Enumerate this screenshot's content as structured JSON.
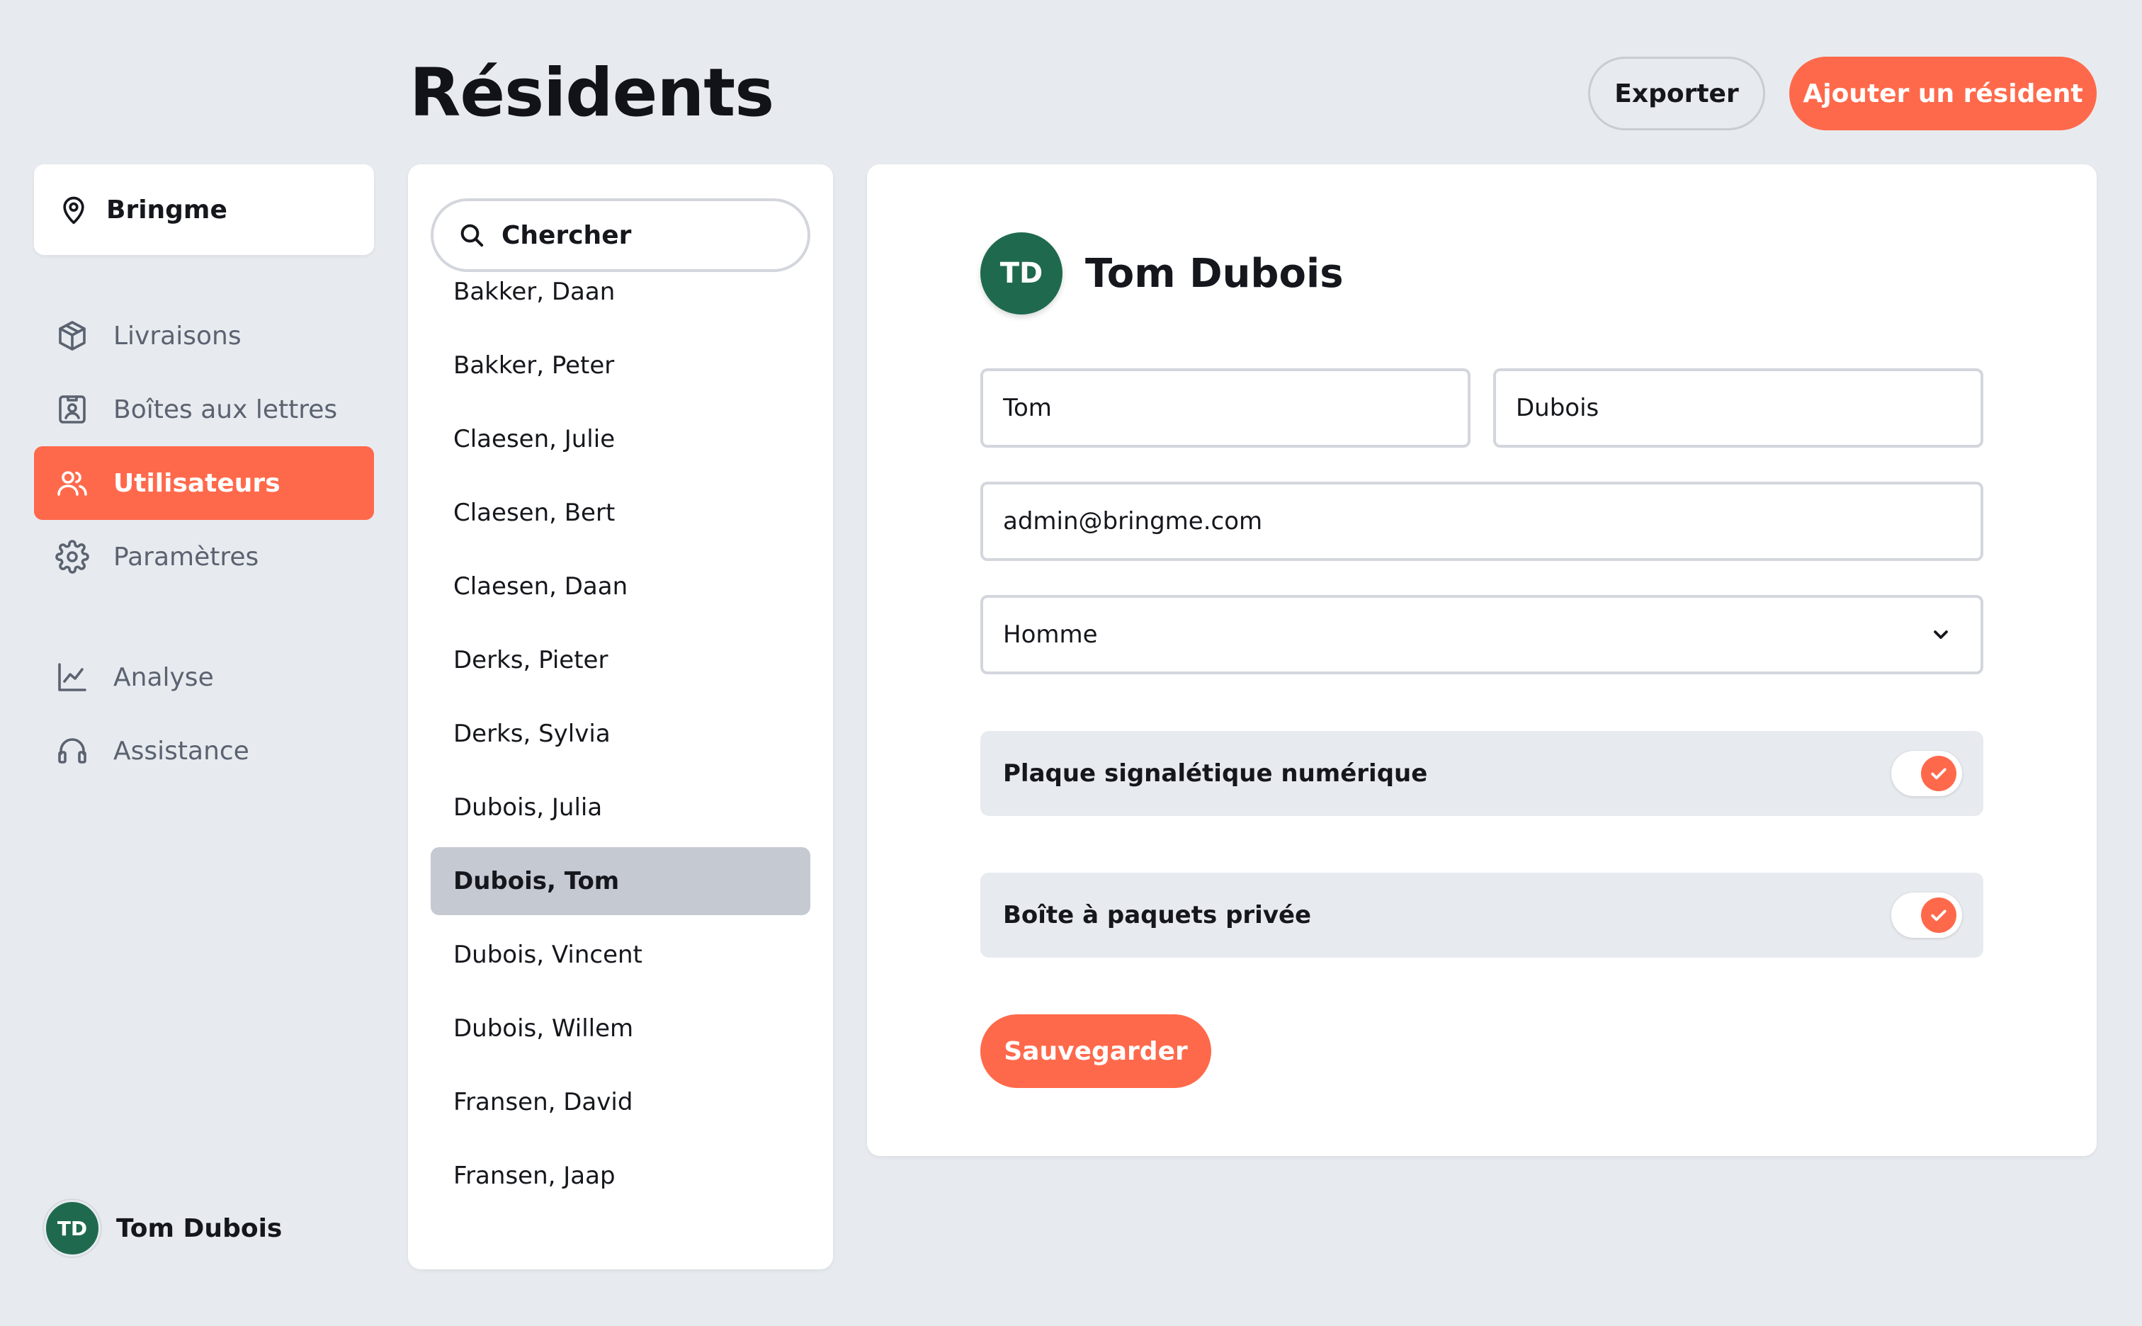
{
  "header": {
    "title": "Résidents",
    "export_label": "Exporter",
    "add_label": "Ajouter un résident"
  },
  "sidebar": {
    "org": {
      "label": "Bringme",
      "icon": "location-pin-icon"
    },
    "items": [
      {
        "label": "Livraisons",
        "icon": "package-icon",
        "active": false
      },
      {
        "label": "Boîtes aux lettres",
        "icon": "mailbox-icon",
        "active": false
      },
      {
        "label": "Utilisateurs",
        "icon": "users-icon",
        "active": true
      },
      {
        "label": "Paramètres",
        "icon": "gear-icon",
        "active": false
      },
      {
        "label": "Analyse",
        "icon": "chart-icon",
        "active": false
      },
      {
        "label": "Assistance",
        "icon": "headset-icon",
        "active": false
      }
    ],
    "user": {
      "initials": "TD",
      "name": "Tom Dubois"
    }
  },
  "list": {
    "search_placeholder": "Chercher",
    "items": [
      "Bakker, Daan",
      "Bakker, Peter",
      "Claesen, Julie",
      "Claesen, Bert",
      "Claesen, Daan",
      "Derks, Pieter",
      "Derks, Sylvia",
      "Dubois, Julia",
      "Dubois, Tom",
      "Dubois, Vincent",
      "Dubois, Willem",
      "Fransen, David",
      "Fransen, Jaap"
    ],
    "selected_index": 8
  },
  "detail": {
    "initials": "TD",
    "name": "Tom Dubois",
    "first_name": "Tom",
    "last_name": "Dubois",
    "email": "admin@bringme.com",
    "gender": "Homme",
    "toggles": [
      {
        "label": "Plaque signalétique numérique",
        "checked": true
      },
      {
        "label": "Boîte à paquets privée",
        "checked": true
      }
    ],
    "save_label": "Sauvegarder"
  },
  "colors": {
    "accent": "#ff694b",
    "avatar": "#1f6a4e",
    "background": "#e7ebef",
    "selected_row": "#c5c9d2"
  }
}
